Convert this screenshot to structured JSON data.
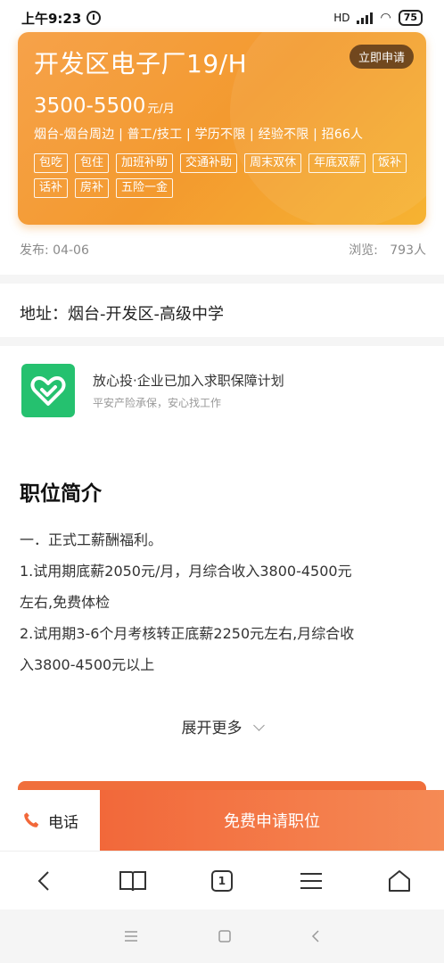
{
  "status_bar": {
    "time": "上午9:23",
    "network": "HD",
    "battery": "75"
  },
  "job": {
    "title": "开发区电子厂19/H",
    "apply_now": "立即申请",
    "salary": "3500-5500",
    "salary_unit": "元/月",
    "meta": "烟台-烟台周边 | 普工/技工 | 学历不限 | 经验不限 | 招66人",
    "tags": [
      "包吃",
      "包住",
      "加班补助",
      "交通补助",
      "周末双休",
      "年底双薪",
      "饭补",
      "话补",
      "房补",
      "五险一金"
    ]
  },
  "publish": {
    "date": "发布: 04-06",
    "views_label": "浏览:",
    "views": "793人"
  },
  "address": "地址：烟台-开发区-高级中学",
  "guarantee": {
    "title": "放心投·企业已加入求职保障计划",
    "subtitle": "平安产险承保，安心找工作"
  },
  "section": {
    "title": "职位简介",
    "lines": [
      "一．正式工薪酬福利。",
      "1.试用期底薪2050元/月，月综合收入3800-4500元",
      "左右,免费体检",
      "2.试用期3-6个月考核转正底薪2250元左右,月综合收",
      "入3800-4500元以上"
    ],
    "expand_more": "展开更多"
  },
  "actions": {
    "phone": "电话",
    "apply": "免费申请职位"
  },
  "browser_nav": {
    "tab_count": "1"
  },
  "colors": {
    "accent": "#f39a2f",
    "apply": "#f2683a",
    "guarantee": "#25c16f"
  }
}
